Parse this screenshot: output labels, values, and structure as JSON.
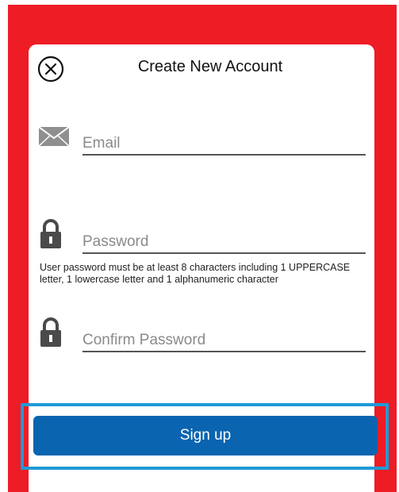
{
  "header": {
    "title": "Create New Account"
  },
  "fields": {
    "email_placeholder": "Email",
    "password_placeholder": "Password",
    "confirm_placeholder": "Confirm Password"
  },
  "password_hint": "User password must be at least 8 characters including 1 UPPERCASE letter, 1 lowercase letter and 1 alphanumeric character",
  "actions": {
    "signup_label": "Sign up"
  },
  "colors": {
    "background": "#ee1c25",
    "button": "#0a64b0",
    "highlight": "#1f9ad6"
  },
  "icons": {
    "close": "close-circle-icon",
    "email": "envelope-icon",
    "password": "lock-icon"
  }
}
